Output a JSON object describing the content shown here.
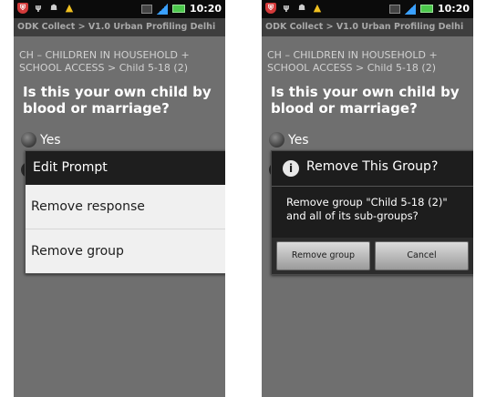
{
  "statusbar": {
    "time": "10:20",
    "icons": [
      "shield-icon",
      "usb-icon",
      "android-icon",
      "warning-icon",
      "flag-icon",
      "signal-icon",
      "battery-icon"
    ]
  },
  "app_title": "ODK Collect > V1.0 Urban Profiling Delhi",
  "breadcrumb": "CH – CHILDREN IN HOUSEHOLD + SCHOOL ACCESS > Child 5-18 (2)",
  "question": "Is this your own child by blood or marriage?",
  "option_yes": "Yes",
  "left_menu": {
    "title": "Edit Prompt",
    "items": [
      "Remove response",
      "Remove group"
    ]
  },
  "right_dialog": {
    "title": "Remove This Group?",
    "message": "Remove group \"Child 5-18 (2)\" and all of its sub-groups?",
    "buttons": [
      "Remove group",
      "Cancel"
    ]
  },
  "colors": {
    "screen_bg": "#6f6f6f",
    "titlebar_bg": "#3e3e3e",
    "statusbar_bg": "#0b0b0b",
    "menu_item_bg": "#f0f0f0",
    "dialog_bg": "#1d1d1d"
  }
}
